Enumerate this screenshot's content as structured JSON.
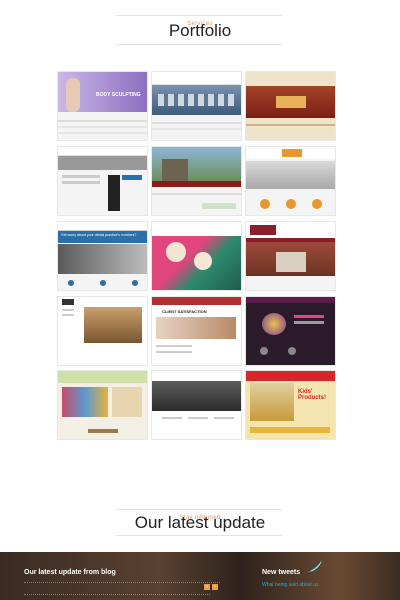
{
  "portfolio": {
    "kicker": "Services",
    "title": "Portfolio"
  },
  "updates": {
    "kicker": "Stay Informed",
    "title": "Our latest update"
  },
  "footer": {
    "blog_title": "Our latest update from blog",
    "tweets_title": "New tweets",
    "tweets_sub": "What being said about us",
    "pager_prev": "‹",
    "pager_next": "›"
  },
  "tiles": [
    {
      "banner_text": "BODY SCULPTING",
      "accent": "#9b7fc6"
    },
    {
      "accent": "#3a6ea5"
    },
    {
      "accent": "#b9572a"
    },
    {
      "accent": "#2b2b2b"
    },
    {
      "accent": "#6a8e58"
    },
    {
      "accent": "#e8962e"
    },
    {
      "banner_text": "Get worry about your dental practice's numbers?",
      "accent": "#2a6fa8"
    },
    {
      "accent": "#e0457b"
    },
    {
      "accent": "#8a1f2b"
    },
    {
      "accent": "#333333"
    },
    {
      "banner_text": "CLIENT SATISFACTION",
      "accent": "#b03030"
    },
    {
      "accent": "#5a1a4a"
    },
    {
      "accent": "#7b9a3a"
    },
    {
      "accent": "#555555"
    },
    {
      "banner_text": "Kids' Products!",
      "accent": "#d7262a"
    }
  ]
}
